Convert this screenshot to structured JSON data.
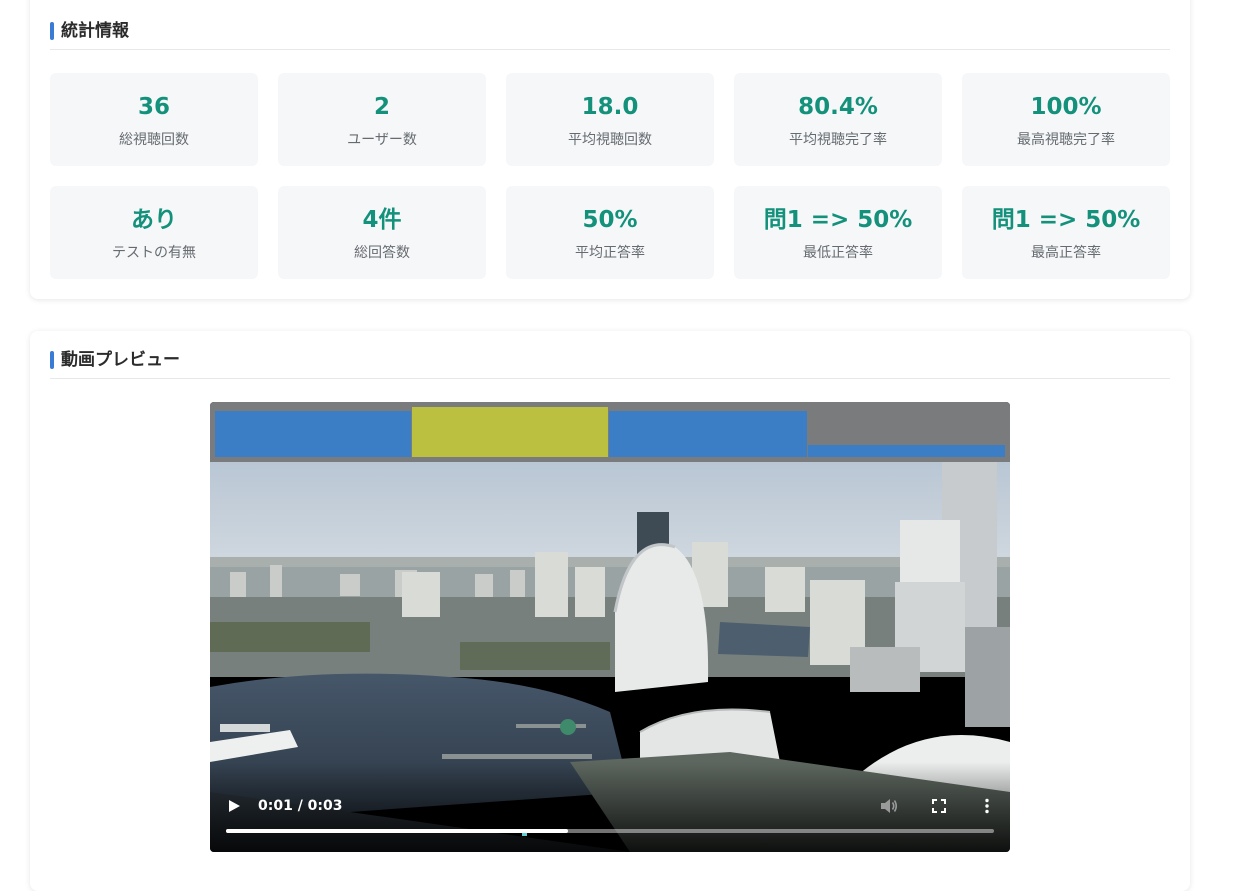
{
  "stats": {
    "title": "統計情報",
    "items": [
      {
        "value": "36",
        "label": "総視聴回数"
      },
      {
        "value": "2",
        "label": "ユーザー数"
      },
      {
        "value": "18.0",
        "label": "平均視聴回数"
      },
      {
        "value": "80.4%",
        "label": "平均視聴完了率"
      },
      {
        "value": "100%",
        "label": "最高視聴完了率"
      },
      {
        "value": "あり",
        "label": "テストの有無"
      },
      {
        "value": "4件",
        "label": "総回答数"
      },
      {
        "value": "50%",
        "label": "平均正答率"
      },
      {
        "value": "問1 => 50%",
        "label": "最低正答率"
      },
      {
        "value": "問1 => 50%",
        "label": "最高正答率"
      }
    ]
  },
  "video": {
    "title": "動画プレビュー",
    "time_display": "0:01 / 0:03",
    "progress_fraction": 0.445,
    "icons": {
      "play": "play-icon",
      "volume": "volume-icon",
      "fullscreen": "fullscreen-icon",
      "more": "more-options-icon"
    }
  },
  "colors": {
    "accent": "#3a7bd5",
    "stat_value": "#13917b",
    "stat_box_bg": "#f6f7f9"
  }
}
